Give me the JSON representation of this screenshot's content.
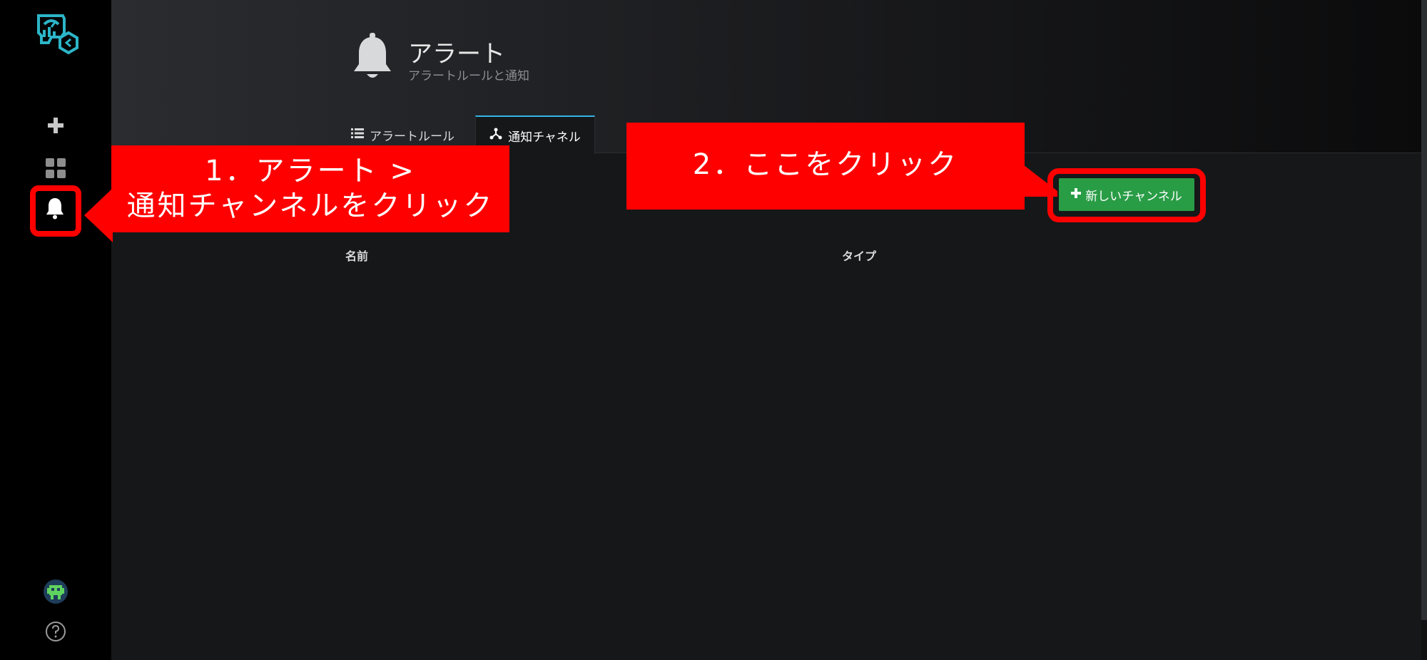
{
  "page": {
    "title": "アラート",
    "subtitle": "アラートルールと通知"
  },
  "tabs": [
    {
      "label": "アラートルール",
      "icon": "list-icon",
      "active": false
    },
    {
      "label": "通知チャネル",
      "icon": "share-icon",
      "active": true
    }
  ],
  "table": {
    "columns": [
      "名前",
      "タイプ"
    ]
  },
  "actions": {
    "new_channel_label": "新しいチャンネル",
    "new_channel_color": "#299c46"
  },
  "sidebar": {
    "items": [
      {
        "name": "add",
        "icon": "plus-icon"
      },
      {
        "name": "dashboards",
        "icon": "grid-icon"
      },
      {
        "name": "alerting",
        "icon": "bell-icon",
        "active": true
      },
      {
        "name": "profile",
        "icon": "avatar-icon"
      },
      {
        "name": "help",
        "icon": "question-icon"
      }
    ]
  },
  "annotations": {
    "step1_line1": "1．アラート >",
    "step1_line2": "通知チャンネルをクリック",
    "step2": "2．ここをクリック",
    "color": "#ff0000"
  },
  "theme": {
    "accent": "#33b5e5",
    "background": "#161719",
    "sidebar": "#000000"
  }
}
